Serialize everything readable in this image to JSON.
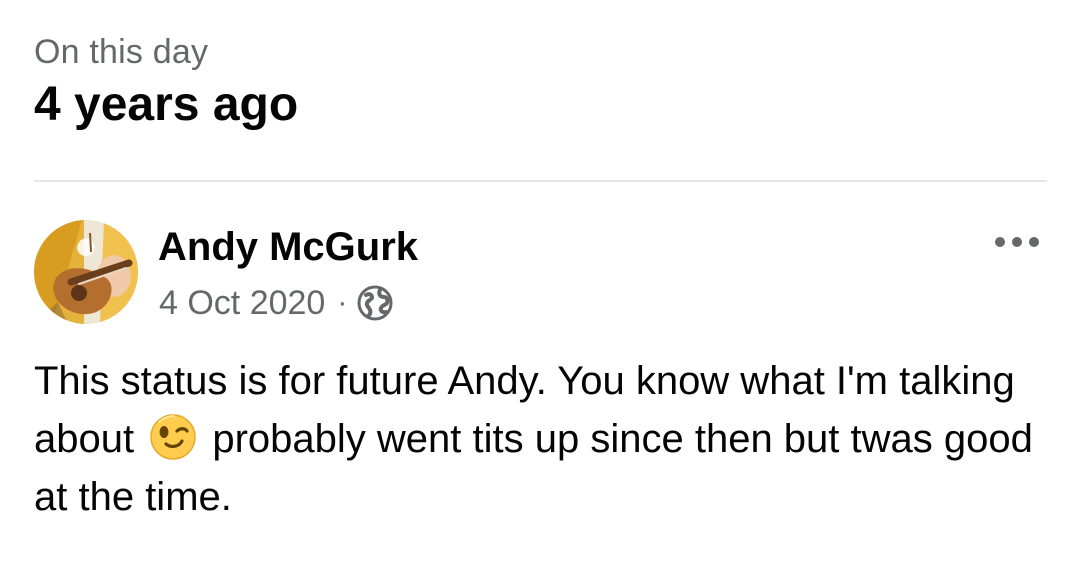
{
  "memory": {
    "kicker": "On this day",
    "title": "4 years ago"
  },
  "post": {
    "author": "Andy McGurk",
    "date": "4 Oct 2020",
    "separator": "·",
    "privacy_icon": "globe-icon",
    "more_icon": "more-options-icon",
    "avatar_icon": "profile-avatar",
    "body_before_emoji": "This status is for future Andy. You know what I'm talking about",
    "emoji_icon": "winking-face-emoji",
    "body_after_emoji": "probably went tits up since then but twas good at the time."
  },
  "colors": {
    "text_primary": "#050505",
    "text_secondary": "#65676b",
    "divider": "#e4e6eb",
    "emoji_yellow": "#ffcc4d"
  }
}
